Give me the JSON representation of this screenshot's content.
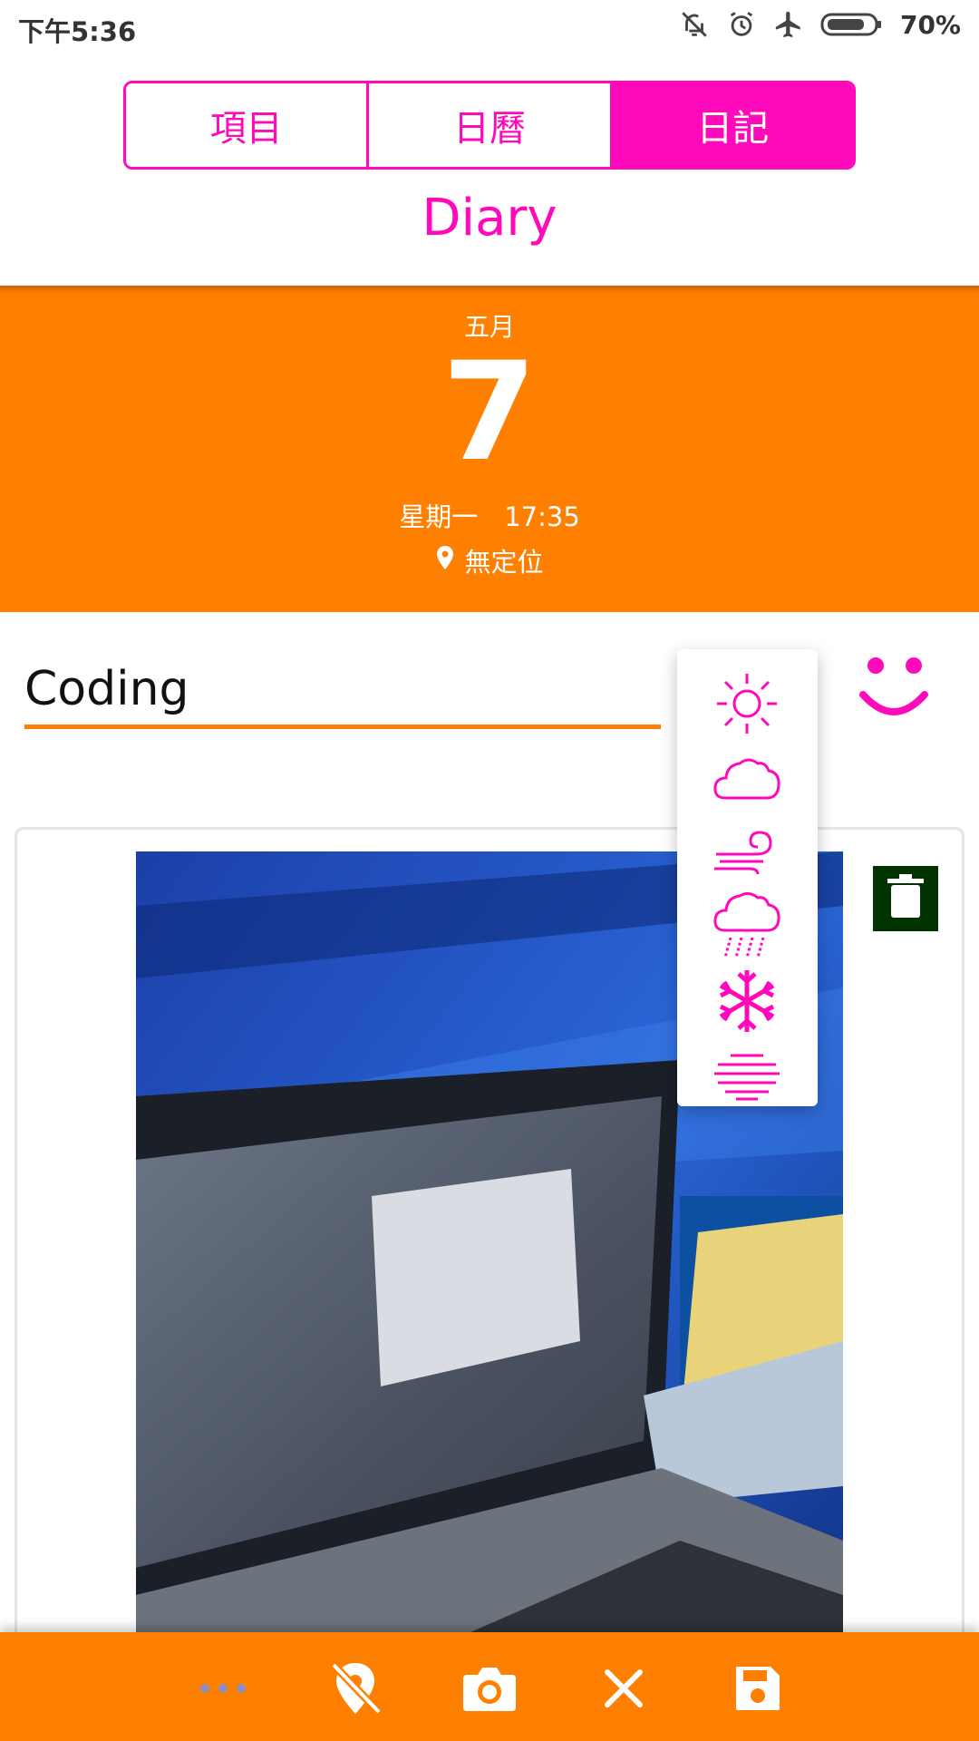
{
  "status_bar": {
    "time": "下午5:36",
    "battery": "70%",
    "icons": [
      "bell-off-icon",
      "alarm-icon",
      "airplane-icon",
      "battery-icon"
    ]
  },
  "tabs": [
    {
      "label": "項目",
      "active": false
    },
    {
      "label": "日曆",
      "active": false
    },
    {
      "label": "日記",
      "active": true
    }
  ],
  "app_title": "Diary",
  "date_header": {
    "month": "五月",
    "day": "7",
    "weekday_time": "星期一　17:35",
    "location": "無定位"
  },
  "entry": {
    "title": "Coding"
  },
  "weather_menu": {
    "items": [
      "sunny-icon",
      "cloudy-icon",
      "windy-icon",
      "rain-icon",
      "snow-icon",
      "fog-icon"
    ]
  },
  "mood": "smile-icon",
  "bottom_bar": {
    "buttons": [
      "more-icon",
      "location-off-icon",
      "camera-icon",
      "close-icon",
      "save-icon"
    ]
  },
  "colors": {
    "accent": "#ff0aba",
    "header": "#ff8000",
    "delete_bg": "#003300"
  }
}
